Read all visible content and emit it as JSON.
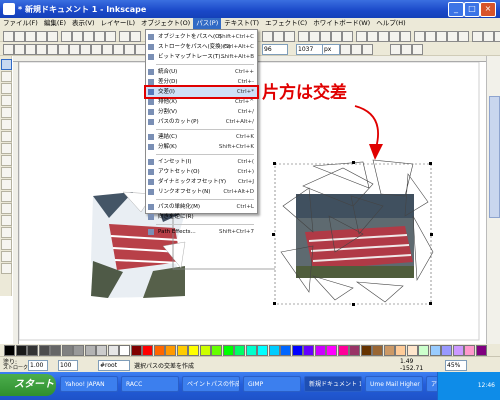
{
  "window": {
    "title": "* 新規ドキュメント 1 - Inkscape",
    "controls": [
      "_",
      "□",
      "×"
    ]
  },
  "menubar": {
    "items": [
      "ファイル(F)",
      "編集(E)",
      "表示(V)",
      "レイヤー(L)",
      "オブジェクト(O)",
      "パス(P)",
      "テキスト(T)",
      "エフェクト(C)",
      "ホワイトボード(W)",
      "ヘルプ(H)"
    ],
    "active_index": 5
  },
  "tool_controls": {
    "x_value": "96",
    "y_value": "1037",
    "unit": "px"
  },
  "path_menu": {
    "items": [
      {
        "icon": "object-to-path-icon",
        "label": "オブジェクトをパスへ(O)",
        "shortcut": "Shift+Ctrl+C"
      },
      {
        "icon": "stroke-to-path-icon",
        "label": "ストロークをパスへ(変換)(S)",
        "shortcut": "Ctrl+Alt+C"
      },
      {
        "icon": "trace-bitmap-icon",
        "label": "ビットマップトレース(T)...",
        "shortcut": "Shift+Alt+B"
      },
      {
        "separator": true
      },
      {
        "icon": "union-icon",
        "label": "統合(U)",
        "shortcut": "Ctrl++"
      },
      {
        "icon": "difference-icon",
        "label": "差分(D)",
        "shortcut": "Ctrl+-"
      },
      {
        "icon": "intersection-icon",
        "label": "交差(I)",
        "shortcut": "Ctrl+*",
        "highlighted": true
      },
      {
        "icon": "exclusion-icon",
        "label": "排他(X)",
        "shortcut": "Ctrl+^"
      },
      {
        "icon": "division-icon",
        "label": "分割(V)",
        "shortcut": "Ctrl+/"
      },
      {
        "icon": "cut-path-icon",
        "label": "パスのカット(P)",
        "shortcut": "Ctrl+Alt+/"
      },
      {
        "separator": true
      },
      {
        "icon": "combine-icon",
        "label": "連結(C)",
        "shortcut": "Ctrl+K"
      },
      {
        "icon": "break-apart-icon",
        "label": "分解(K)",
        "shortcut": "Shift+Ctrl+K"
      },
      {
        "separator": true
      },
      {
        "icon": "inset-icon",
        "label": "インセット(I)",
        "shortcut": "Ctrl+("
      },
      {
        "icon": "outset-icon",
        "label": "アウトセット(O)",
        "shortcut": "Ctrl+)"
      },
      {
        "icon": "dynamic-offset-icon",
        "label": "ダイナミックオフセット(Y)",
        "shortcut": "Ctrl+J"
      },
      {
        "icon": "linked-offset-icon",
        "label": "リンクオフセット(N)",
        "shortcut": "Ctrl+Alt+D"
      },
      {
        "separator": true
      },
      {
        "icon": "simplify-icon",
        "label": "パスの単純化(M)",
        "shortcut": "Ctrl+L"
      },
      {
        "icon": "reverse-icon",
        "label": "向きを逆に(R)",
        "shortcut": ""
      },
      {
        "separator": true
      },
      {
        "icon": "path-effects-icon",
        "label": "Path Effects...",
        "shortcut": "Shift+Ctrl+7"
      }
    ]
  },
  "annotation": {
    "text": "片方は交差",
    "color": "#e00000"
  },
  "palette": {
    "colors": [
      "#000000",
      "#1a1a1a",
      "#333333",
      "#4d4d4d",
      "#666666",
      "#808080",
      "#999999",
      "#b3b3b3",
      "#cccccc",
      "#e6e6e6",
      "#ffffff",
      "#800000",
      "#ff0000",
      "#ff6600",
      "#ff9900",
      "#ffcc00",
      "#ffff00",
      "#ccff00",
      "#66ff00",
      "#00ff00",
      "#00ff66",
      "#00ffcc",
      "#00ffff",
      "#00ccff",
      "#0066ff",
      "#0000ff",
      "#6600ff",
      "#cc00ff",
      "#ff00ff",
      "#ff0099",
      "#993366",
      "#663300",
      "#996633",
      "#cc9966",
      "#ffcc99",
      "#ffe6cc",
      "#ccffcc",
      "#99ccff",
      "#9999ff",
      "#cc99ff",
      "#ff99cc",
      "#800080"
    ]
  },
  "statusbar": {
    "fill_label": "塗り:",
    "stroke_label": "ストローク:",
    "stroke_width": "1.00",
    "opacity_value": "100",
    "layer": "#root",
    "message": "選択パスの交差を作成",
    "x_coord": "1.49",
    "y_coord": "-152.71",
    "zoom": "45%"
  },
  "taskbar": {
    "start_label": "スタート",
    "tasks": [
      {
        "label": "Yahoo! JAPAN",
        "active": false
      },
      {
        "label": "RACC",
        "active": false
      },
      {
        "label": "ペイントパスの作成",
        "active": false
      },
      {
        "label": "GIMP",
        "active": false
      },
      {
        "label": "新規ドキュメント 1",
        "active": true
      },
      {
        "label": "Ume Mail Higher",
        "active": false
      },
      {
        "label": "アイテム",
        "active": false
      }
    ],
    "tray_time": "12:46"
  }
}
